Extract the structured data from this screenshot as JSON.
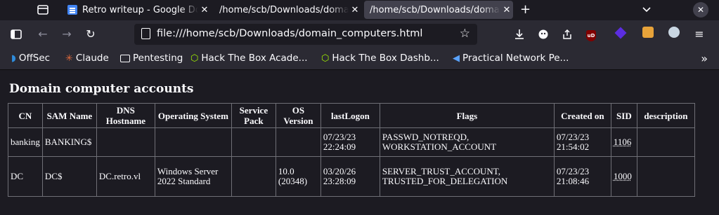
{
  "tabs": [
    {
      "title": "Retro writeup - Google Docs",
      "active": false
    },
    {
      "title": "/home/scb/Downloads/domain_computers.html",
      "active": false
    },
    {
      "title": "/home/scb/Downloads/domain_computers.html",
      "active": true
    }
  ],
  "nav": {
    "url": "file:///home/scb/Downloads/domain_computers.html"
  },
  "bookmarks": [
    {
      "label": "OffSec",
      "icon": "offsec-icon"
    },
    {
      "label": "Claude",
      "icon": "claude-icon"
    },
    {
      "label": "Pentesting",
      "icon": "folder-icon"
    },
    {
      "label": "Hack The Box Acade...",
      "icon": "htb-icon"
    },
    {
      "label": "Hack The Box Dashb...",
      "icon": "htb-icon"
    },
    {
      "label": "Practical Network Pe...",
      "icon": "pnp-icon"
    }
  ],
  "page": {
    "title": "Domain computer accounts",
    "columns": [
      "CN",
      "SAM Name",
      "DNS Hostname",
      "Operating System",
      "Service Pack",
      "OS Version",
      "lastLogon",
      "Flags",
      "Created on",
      "SID",
      "description"
    ],
    "rows": [
      {
        "cn": "banking",
        "sam": "BANKING$",
        "dns": "",
        "os": "",
        "sp": "",
        "osver": "",
        "lastlogon": "07/23/23 22:24:09",
        "flags": "PASSWD_NOTREQD, WORKSTATION_ACCOUNT",
        "created": "07/23/23 21:54:02",
        "sid": "1106",
        "desc": ""
      },
      {
        "cn": "DC",
        "sam": "DC$",
        "dns": "DC.retro.vl",
        "os": "Windows Server 2022 Standard",
        "sp": "",
        "osver": "10.0 (20348)",
        "lastlogon": "03/20/26 23:28:09",
        "flags": "SERVER_TRUST_ACCOUNT, TRUSTED_FOR_DELEGATION",
        "created": "07/23/23 21:08:46",
        "sid": "1000",
        "desc": ""
      }
    ]
  }
}
